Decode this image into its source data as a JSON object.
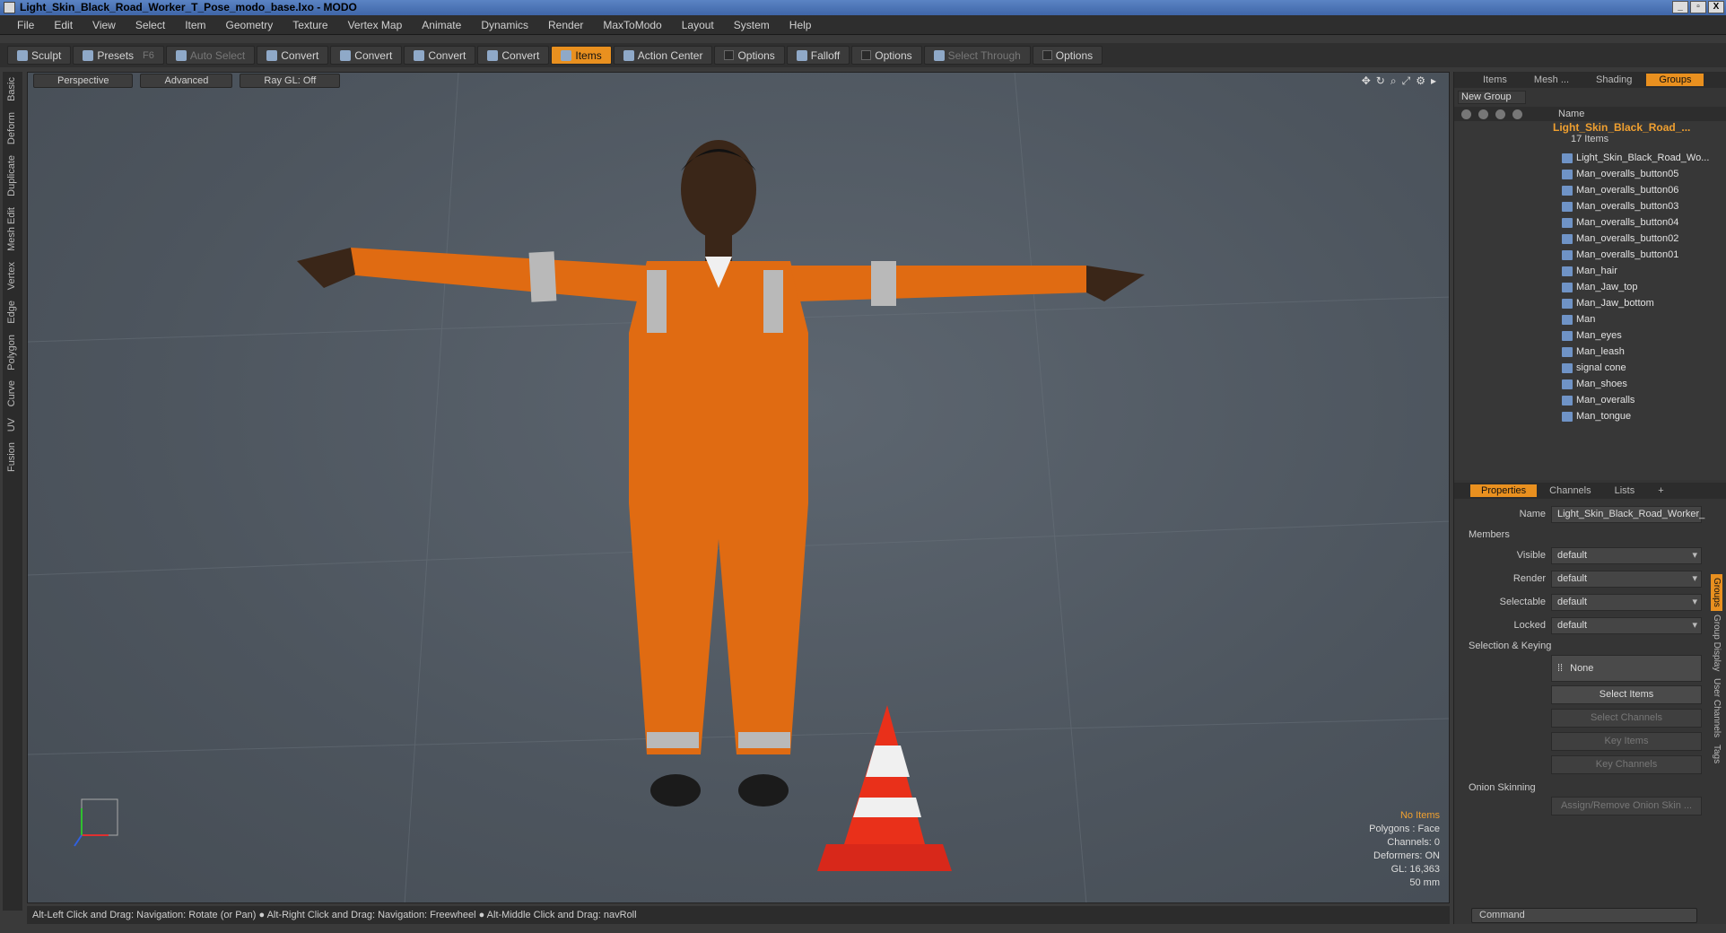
{
  "window": {
    "title": "Light_Skin_Black_Road_Worker_T_Pose_modo_base.lxo - MODO",
    "buttons": [
      "_",
      "▫",
      "X"
    ]
  },
  "menu": [
    "File",
    "Edit",
    "View",
    "Select",
    "Item",
    "Geometry",
    "Texture",
    "Vertex Map",
    "Animate",
    "Dynamics",
    "Render",
    "MaxToModo",
    "Layout",
    "System",
    "Help"
  ],
  "toolbar": {
    "sculpt": "Sculpt",
    "presets": "Presets",
    "presets_key": "F6",
    "auto_select": "Auto Select",
    "convert1": "Convert",
    "convert2": "Convert",
    "convert3": "Convert",
    "convert4": "Convert",
    "items": "Items",
    "action_center": "Action Center",
    "options1": "Options",
    "falloff": "Falloff",
    "options2": "Options",
    "select_through": "Select Through",
    "options3": "Options"
  },
  "left_tabs": [
    "Basic",
    "Deform",
    "Duplicate",
    "Mesh Edit",
    "Vertex",
    "Edge",
    "Polygon",
    "Curve",
    "UV",
    "Fusion"
  ],
  "viewport": {
    "view": "Perspective",
    "mode": "Advanced",
    "raygl": "Ray GL: Off",
    "info": {
      "items": "No Items",
      "polygons": "Polygons : Face",
      "channels": "Channels: 0",
      "deformers": "Deformers: ON",
      "gl": "GL: 16,363",
      "scale": "50 mm"
    }
  },
  "status": "Alt-Left Click and Drag: Navigation: Rotate (or Pan) ● Alt-Right Click and Drag: Navigation: Freewheel ● Alt-Middle Click and Drag: navRoll",
  "scene_panel": {
    "tabs": [
      "Items",
      "Mesh ...",
      "Shading",
      "Groups"
    ],
    "active_tab": "Groups",
    "new_group": "New Group",
    "name_col": "Name",
    "group_name": "Light_Skin_Black_Road_...",
    "group_count": "17 Items",
    "items": [
      "Light_Skin_Black_Road_Wo...",
      "Man_overalls_button05",
      "Man_overalls_button06",
      "Man_overalls_button03",
      "Man_overalls_button04",
      "Man_overalls_button02",
      "Man_overalls_button01",
      "Man_hair",
      "Man_Jaw_top",
      "Man_Jaw_bottom",
      "Man",
      "Man_eyes",
      "Man_leash",
      "signal cone",
      "Man_shoes",
      "Man_overalls",
      "Man_tongue"
    ]
  },
  "properties": {
    "tabs": [
      "Properties",
      "Channels",
      "Lists",
      "+"
    ],
    "name_label": "Name",
    "name_value": "Light_Skin_Black_Road_Worker_",
    "members": "Members",
    "visible_label": "Visible",
    "visible": "default",
    "render_label": "Render",
    "render": "default",
    "selectable_label": "Selectable",
    "selectable": "default",
    "locked_label": "Locked",
    "locked": "default",
    "selection_keying": "Selection & Keying",
    "none": "None",
    "select_items": "Select Items",
    "select_channels": "Select Channels",
    "key_items": "Key Items",
    "key_channels": "Key Channels",
    "onion": "Onion Skinning",
    "assign_onion": "Assign/Remove Onion Skin ..."
  },
  "right_vtabs": [
    "Groups",
    "Group Display",
    "User Channels",
    "Tags"
  ],
  "command_placeholder": "Command"
}
